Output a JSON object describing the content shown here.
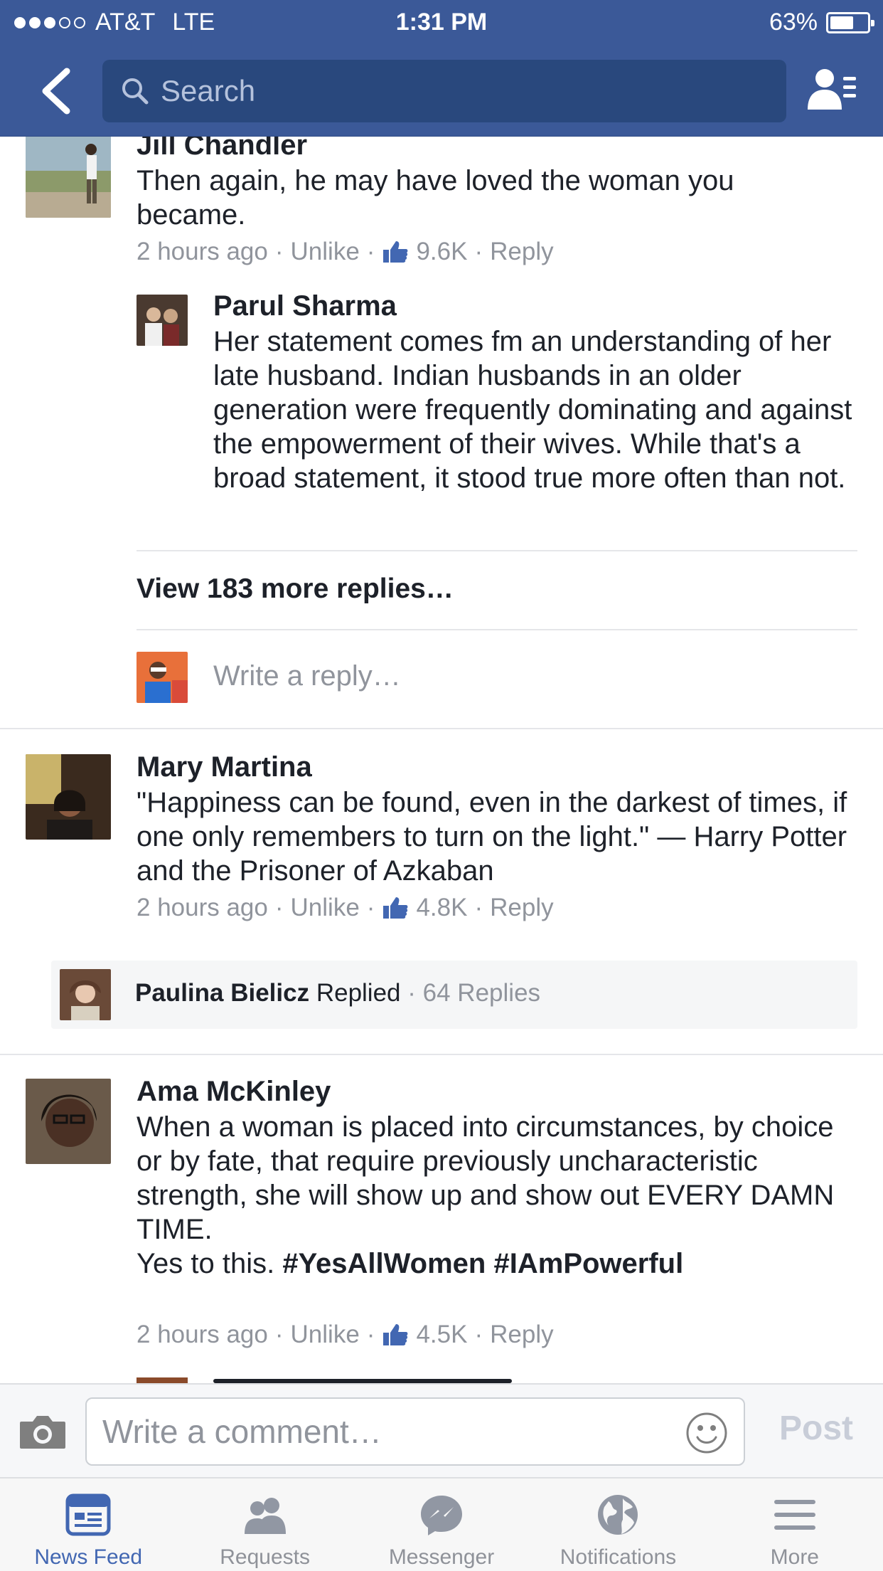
{
  "status_bar": {
    "carrier": "AT&T",
    "network": "LTE",
    "time": "1:31 PM",
    "battery_text": "63%",
    "battery_level": 0.63,
    "signal_bars_filled": 3,
    "signal_bars_total": 5
  },
  "nav": {
    "search_placeholder": "Search",
    "back_icon": "chevron-left-icon",
    "friend_requests_icon": "friend-list-icon"
  },
  "colors": {
    "brand_blue": "#3b5998",
    "search_bg": "#29487d",
    "like_blue": "#4267b2",
    "meta_gray": "#90949c"
  },
  "comments": [
    {
      "author": "Jill Chandler",
      "text": "Then again, he may have loved the woman you became.",
      "time": "2 hours ago",
      "unlike": "Unlike",
      "likes": "9.6K",
      "reply": "Reply",
      "replies": [
        {
          "author": "Parul Sharma",
          "text": "Her statement comes fm an understanding of her late husband. Indian husbands in an older generation were frequently dominating and against the empowerment of their wives. While that's a broad statement, it stood true more often than not."
        }
      ],
      "view_more": "View 183 more replies…",
      "write_reply_placeholder": "Write a reply…"
    },
    {
      "author": "Mary Martina",
      "text": "\"Happiness can be found, even in the darkest of times, if one only remembers to turn on the light.\" — Harry Potter and the Prisoner of Azkaban",
      "time": "2 hours ago",
      "unlike": "Unlike",
      "likes": "4.8K",
      "reply": "Reply",
      "reply_summary": {
        "author": "Paulina Bielicz",
        "action": "Replied",
        "count": "64 Replies"
      }
    },
    {
      "author": "Ama McKinley",
      "text": "When a woman is placed into circumstances, by choice or by fate, that require previously uncharacteristic strength, she will show up and show out EVERY DAMN TIME.",
      "text_line2_prefix": "Yes to this.",
      "hashtags": [
        "#YesAllWomen",
        "#IAmPowerful"
      ],
      "time": "2 hours ago",
      "unlike": "Unlike",
      "likes": "4.5K",
      "reply": "Reply"
    }
  ],
  "composer": {
    "placeholder": "Write a comment…",
    "post_label": "Post"
  },
  "tabs": [
    {
      "label": "News Feed",
      "icon": "news-feed-icon",
      "active": true
    },
    {
      "label": "Requests",
      "icon": "requests-icon",
      "active": false
    },
    {
      "label": "Messenger",
      "icon": "messenger-icon",
      "active": false
    },
    {
      "label": "Notifications",
      "icon": "globe-icon",
      "active": false
    },
    {
      "label": "More",
      "icon": "menu-icon",
      "active": false
    }
  ]
}
